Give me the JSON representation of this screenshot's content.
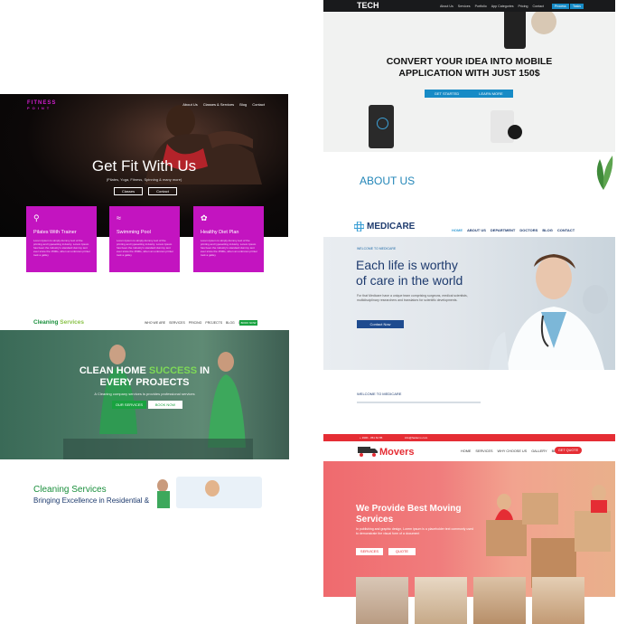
{
  "fitness": {
    "logo_line1": "FITNESS",
    "logo_line2": "POINT",
    "nav": [
      "About Us",
      "Classes & Services",
      "Blog",
      "Contact"
    ],
    "title": "Get Fit With Us",
    "subtitle": "(Pilates, Yoga, Fitness, Spinning & many more)",
    "buttons": [
      "Classes",
      "Contact"
    ],
    "features": [
      {
        "title": "Pilates With Trainer",
        "text": "Lorem Ipsum is simply dummy text of the printing and typesetting industry. Lorem Ipsum has been the industry's standard dummy text ever since the 1500s, when an unknown printer took a galley"
      },
      {
        "title": "Swimming Pool",
        "text": "Lorem Ipsum is simply dummy text of the printing and typesetting industry. Lorem Ipsum has been the industry's standard dummy text ever since the 1500s, when an unknown printer took a galley"
      },
      {
        "title": "Healthy Diet Plan",
        "text": "Lorem Ipsum is simply dummy text of the printing and typesetting industry. Lorem Ipsum has been the industry's standard dummy text ever since the 1500s, when an unknown printer took a galley"
      }
    ],
    "accent": "#c314c0"
  },
  "tech": {
    "logo": "TECH",
    "nav": [
      "About Us",
      "Services",
      "Portfolio",
      "App Categories",
      "Pricing",
      "Contact"
    ],
    "nav_buttons": [
      "Process",
      "Tasks"
    ],
    "headline_1": "CONVERT YOUR IDEA INTO MOBILE",
    "headline_2": "APPLICATION WITH JUST 150$",
    "btn_start": "GET STARTED",
    "btn_learn": "LEARN MORE",
    "about": "ABOUT US",
    "accent": "#178bc6"
  },
  "medicare": {
    "logo": "MEDICARE",
    "nav": [
      "HOME",
      "ABOUT US",
      "DEPARTMENT",
      "DOCTORS",
      "BLOG",
      "CONTACT"
    ],
    "welcome": "WELCOME TO MEDICARE",
    "headline_1": "Each life is worthy",
    "headline_2": "of care in the world",
    "desc": "For that Medicare have a unique team comprising surgeons, medical scientists, multidisciplinary researchers and translators for scientific developments.",
    "contact_btn": "Contact Now",
    "welcome_2": "WELCOME TO MEDICARE",
    "accent": "#1e3b6e"
  },
  "cleaning": {
    "logo_1": "Cleaning",
    "logo_2": "Services",
    "nav": [
      "WHO WE ARE",
      "SERVICES",
      "PRICING",
      "PROJECTS",
      "BLOG",
      "CONTACT"
    ],
    "nav_btn": "BOOK NOW",
    "headline_1a": "CLEAN HOME",
    "headline_1b": "SUCCESS",
    "headline_1c": "IN",
    "headline_2": "EVERY PROJECTS",
    "subtitle": "A Cleaning company services is provides professional services",
    "btn_services": "OUR SERVICES",
    "btn_book": "BOOK NOW",
    "section_title": "Cleaning Services",
    "section_sub": "Bringing Excellence in Residential &",
    "accent": "#19a340"
  },
  "movers": {
    "phone": "+ 1900 - 351 64 85",
    "email": "info@hademo.com",
    "logo": "Movers",
    "nav": [
      "HOME",
      "SERVICES",
      "WHY CHOOSE US",
      "GALLERY",
      "BLOG"
    ],
    "quote_btn": "GET QUOTE",
    "headline_1": "We Provide Best Moving",
    "headline_2": "Services",
    "desc": "In publishing and graphic design, Lorem ipsum is a placeholder text commonly used to demonstrate the visual form of a document",
    "btn_services": "SERVICES",
    "btn_quote": "QUOTE",
    "accent": "#e52d34"
  }
}
